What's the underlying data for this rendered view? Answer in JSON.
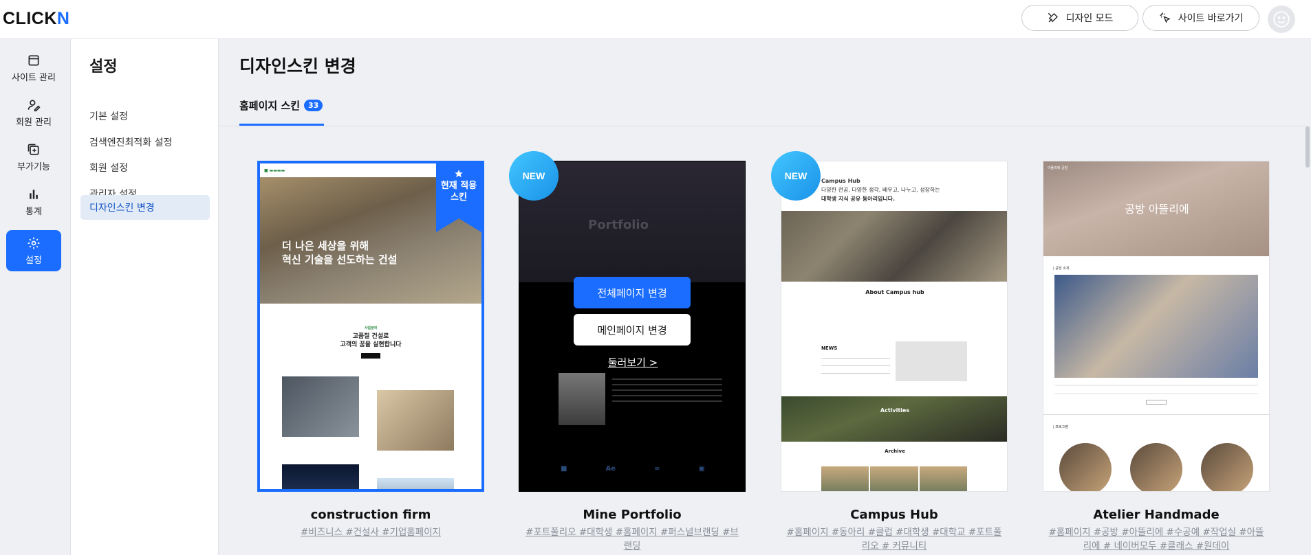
{
  "header": {
    "logo_main": "CLICK",
    "logo_accent": "N",
    "design_mode_label": "디자인 모드",
    "site_shortcut_label": "사이트 바로가기"
  },
  "rail": {
    "items": [
      {
        "label": "사이트 관리",
        "icon": "browser-window-icon"
      },
      {
        "label": "회원 관리",
        "icon": "user-edit-icon"
      },
      {
        "label": "부가기능",
        "icon": "plus-square-icon"
      },
      {
        "label": "통계",
        "icon": "bar-chart-icon"
      },
      {
        "label": "설정",
        "icon": "gear-icon",
        "active": true
      }
    ]
  },
  "submenu": {
    "title": "설정",
    "items": [
      {
        "label": "기본 설정"
      },
      {
        "label": "검색엔진최적화 설정"
      },
      {
        "label": "회원 설정"
      },
      {
        "label": "관리자 설정"
      },
      {
        "label": "디자인스킨 변경",
        "active": true
      }
    ]
  },
  "main": {
    "page_title": "디자인스킨 변경",
    "tab_label": "홈페이지 스킨",
    "tab_count": "33"
  },
  "cards": [
    {
      "title": "construction firm",
      "tags": "#비즈니스 #건설사 #기업홈페이지",
      "current_badge_line1": "현재 적용",
      "current_badge_line2": "스킨",
      "preview_hero_line1": "더 나은 세상을 위해",
      "preview_hero_line2": "혁신 기술을 선도하는 건설",
      "preview_sec_tiny": "사업분야",
      "preview_sec_line1": "고품질 건설로",
      "preview_sec_line2": "고객의 꿈을 실현합니다"
    },
    {
      "title": "Mine Portfolio",
      "tags": "#포트폴리오 #대학생 #홈페이지 #퍼스널브랜딩 #브랜딩",
      "new_label": "NEW",
      "btn_full": "전체페이지 변경",
      "btn_main": "메인페이지 변경",
      "preview_link": "둘러보기 >",
      "preview_word": "Portfolio"
    },
    {
      "title": "Campus Hub",
      "tags": "#홈페이지 #동아리 #클럽 #대학생 #대학교 #포트폴리오 # 커뮤니티",
      "new_label": "NEW",
      "preview_brand": "Campus Hub",
      "preview_intro_line1": "다양한 전공, 다양한 생각, 배우고, 나누고, 성장하는",
      "preview_intro_line2": "대학생 지식 공유 동아리입니다.",
      "preview_about": "About Campus hub",
      "preview_news": "NEWS",
      "preview_activities": "Activities",
      "preview_archive": "Archive"
    },
    {
      "title": "Atelier Handmade",
      "tags": "#홈페이지 #공방 #아뜰리에 #수공예 #작업실 #아뜰리에 # 네이버모두 #클래스 #원데이",
      "preview_brand": "아뜰리에 공방",
      "preview_hero": "공방 아뜰리에",
      "preview_intro": "| 공방 소개",
      "preview_program": "| 프로그램"
    }
  ],
  "colors": {
    "accent": "#1a6dff",
    "new_badge": "#2aa9f2"
  }
}
